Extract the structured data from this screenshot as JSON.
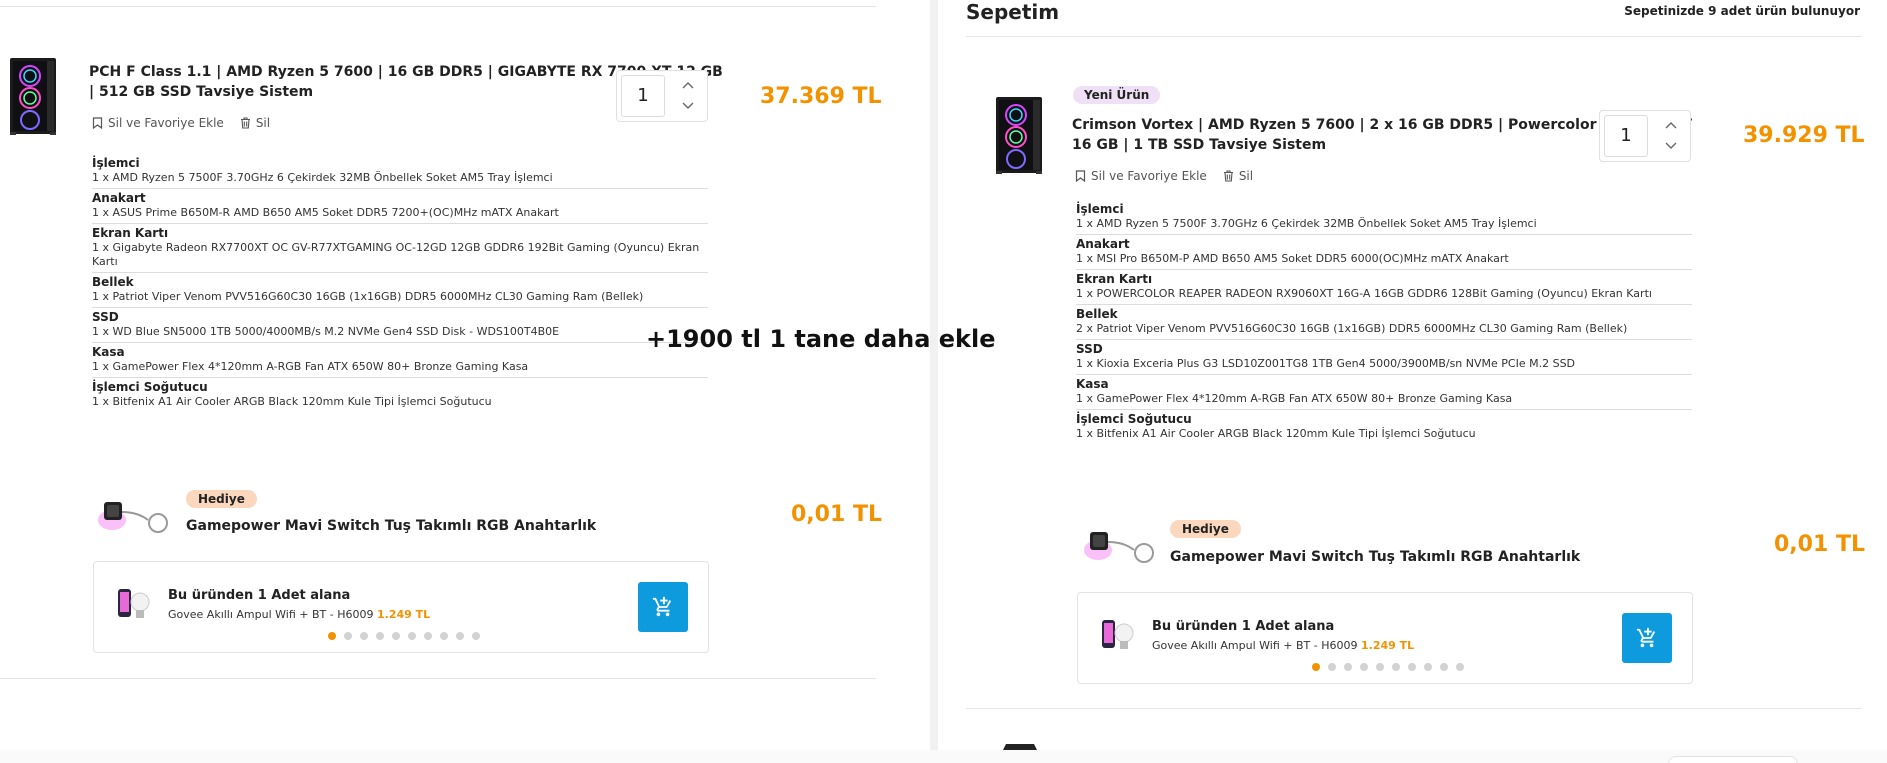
{
  "cart": {
    "title": "Sepetim",
    "count_prefix": "Sepetinizde",
    "count_value": "9 adet",
    "count_suffix": "ürün bulunuyor"
  },
  "left_item": {
    "title_line1": "PCH F Class 1.1 | AMD Ryzen 5 7600 | 16 GB DDR5 | GIGABYTE RX 7700 XT 12 GB",
    "title_line2": "| 512 GB SSD Tavsiye Sistem",
    "actions": {
      "fav": "Sil ve Favoriye Ekle",
      "delete": "Sil"
    },
    "quantity": "1",
    "price": "37.369 TL",
    "specs": [
      {
        "label": "İşlemci",
        "value": "1 x AMD Ryzen 5 7500F 3.70GHz 6 Çekirdek 32MB Önbellek Soket AM5 Tray İşlemci"
      },
      {
        "label": "Anakart",
        "value": "1 x ASUS Prime B650M-R AMD B650 AM5 Soket DDR5 7200+(OC)MHz mATX Anakart"
      },
      {
        "label": "Ekran Kartı",
        "value": "1 x Gigabyte Radeon RX7700XT OC GV-R77XTGAMING OC-12GD 12GB GDDR6 192Bit Gaming (Oyuncu) Ekran Kartı"
      },
      {
        "label": "Bellek",
        "value": "1 x Patriot Viper Venom PVV516G60C30 16GB (1x16GB) DDR5 6000MHz CL30 Gaming Ram (Bellek)"
      },
      {
        "label": "SSD",
        "value": "1 x WD Blue SN5000 1TB 5000/4000MB/s M.2 NVMe Gen4 SSD Disk - WDS100T4B0E"
      },
      {
        "label": "Kasa",
        "value": "1 x GamePower Flex 4*120mm A-RGB Fan ATX 650W 80+ Bronze Gaming Kasa"
      },
      {
        "label": "İşlemci Soğutucu",
        "value": "1 x Bitfenix A1 Air Cooler ARGB Black 120mm Kule Tipi İşlemci Soğutucu"
      }
    ],
    "gift": {
      "badge": "Hediye",
      "name": "Gamepower Mavi Switch Tuş Takımlı RGB Anahtarlık",
      "price": "0,01 TL"
    },
    "offer": {
      "title": "Bu üründen 1 Adet alana",
      "product": "Govee Akıllı Ampul Wifi + BT - H6009",
      "price": "1.249 TL"
    }
  },
  "right_item": {
    "badge": "Yeni Ürün",
    "title_line1": "Crimson Vortex | AMD Ryzen 5 7600 | 2 x 16 GB DDR5 | Powercolor RX 9060 XT",
    "title_line2": "16 GB | 1 TB SSD Tavsiye Sistem",
    "actions": {
      "fav": "Sil ve Favoriye Ekle",
      "delete": "Sil"
    },
    "quantity": "1",
    "price": "39.929 TL",
    "specs": [
      {
        "label": "İşlemci",
        "value": "1 x AMD Ryzen 5 7500F 3.70GHz 6 Çekirdek 32MB Önbellek Soket AM5 Tray İşlemci"
      },
      {
        "label": "Anakart",
        "value": "1 x MSI Pro B650M-P AMD B650 AM5 Soket DDR5 6000(OC)MHz mATX Anakart"
      },
      {
        "label": "Ekran Kartı",
        "value": "1 x POWERCOLOR REAPER RADEON RX9060XT 16G-A 16GB GDDR6 128Bit Gaming (Oyuncu) Ekran Kartı"
      },
      {
        "label": "Bellek",
        "value": "2 x Patriot Viper Venom PVV516G60C30 16GB (1x16GB) DDR5 6000MHz CL30 Gaming Ram (Bellek)"
      },
      {
        "label": "SSD",
        "value": "1 x Kioxia Exceria Plus G3 LSD10Z001TG8 1TB Gen4 5000/3900MB/sn NVMe PCIe M.2 SSD"
      },
      {
        "label": "Kasa",
        "value": "1 x GamePower Flex 4*120mm A-RGB Fan ATX 650W 80+ Bronze Gaming Kasa"
      },
      {
        "label": "İşlemci Soğutucu",
        "value": "1 x Bitfenix A1 Air Cooler ARGB Black 120mm Kule Tipi İşlemci Soğutucu"
      }
    ],
    "gift": {
      "badge": "Hediye",
      "name": "Gamepower Mavi Switch Tuş Takımlı RGB Anahtarlık",
      "price": "0,01 TL"
    },
    "offer": {
      "title": "Bu üründen 1 Adet alana",
      "product": "Govee Akıllı Ampul Wifi + BT - H6009",
      "price": "1.249 TL"
    }
  },
  "annotation": "+1900 tl 1 tane daha ekle",
  "colors": {
    "price": "#f39200",
    "cart_button": "#0d9bde",
    "new_badge": "#efe0f5",
    "gift_badge": "#fbd7bd"
  }
}
